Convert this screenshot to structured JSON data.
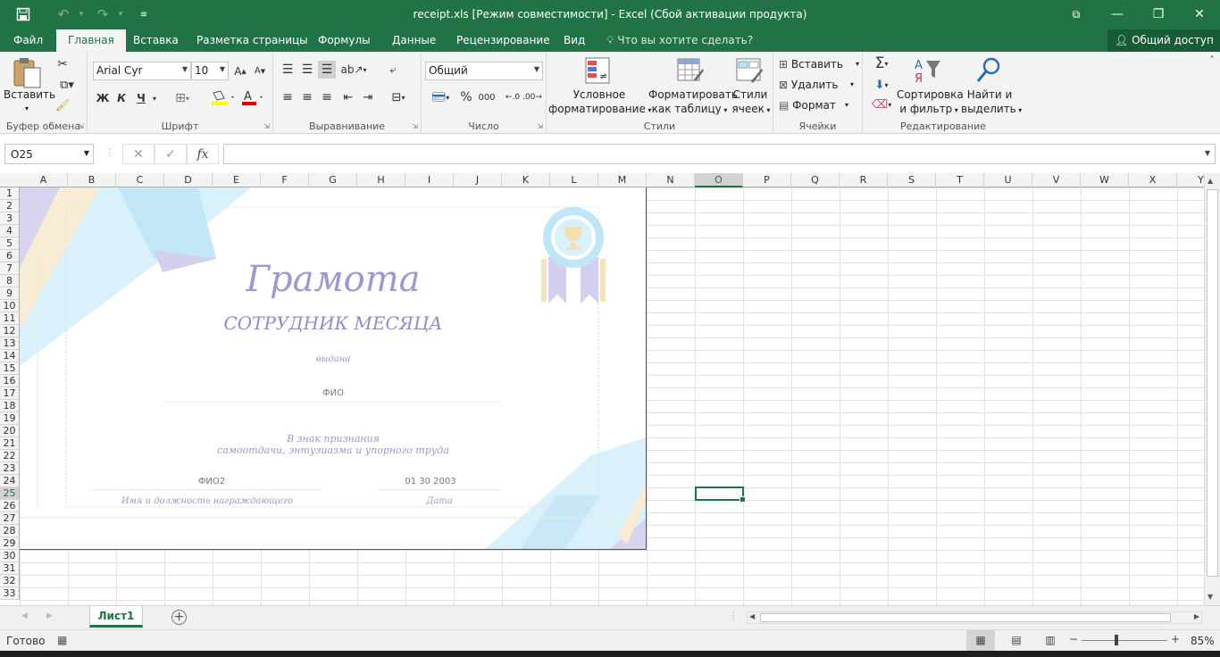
{
  "window": {
    "title": "receipt.xls  [Режим совместимости] - Excel (Сбой активации продукта)",
    "icons": [
      "save-icon",
      "undo-icon",
      "redo-icon",
      "customize-qat-icon"
    ],
    "controls": {
      "ribbon_display": "⧉",
      "minimize": "—",
      "restore": "❐",
      "close": "✕"
    }
  },
  "tabs": [
    {
      "label": "Файл"
    },
    {
      "label": "Главная"
    },
    {
      "label": "Вставка"
    },
    {
      "label": "Разметка страницы"
    },
    {
      "label": "Формулы"
    },
    {
      "label": "Данные"
    },
    {
      "label": "Рецензирование"
    },
    {
      "label": "Вид"
    }
  ],
  "tell_me": "Что вы хотите сделать?",
  "share": "Общий доступ",
  "ribbon": {
    "clipboard": {
      "paste": "Вставить",
      "label": "Буфер обмена"
    },
    "font": {
      "name": "Arial Cyr",
      "size": "10",
      "bold": "Ж",
      "italic": "К",
      "underline": "Ч",
      "label": "Шрифт"
    },
    "alignment": {
      "label": "Выравнивание"
    },
    "number": {
      "format": "Общий",
      "percent": "%",
      "thousands": "000",
      "label": "Число"
    },
    "styles": {
      "conditional": "Условное",
      "conditional2": "форматирование",
      "as_table": "Форматировать",
      "as_table2": "как таблицу",
      "cell_styles": "Стили",
      "cell_styles2": "ячеек",
      "label": "Стили"
    },
    "cells": {
      "insert": "Вставить",
      "delete": "Удалить",
      "format": "Формат",
      "label": "Ячейки"
    },
    "editing": {
      "sort": "Сортировка",
      "sort2": "и фильтр",
      "find": "Найти и",
      "find2": "выделить",
      "label": "Редактирование"
    }
  },
  "formula_bar": {
    "name_box": "O25",
    "cancel": "✕",
    "enter": "✓",
    "fx": "fx",
    "value": ""
  },
  "columns": [
    "A",
    "B",
    "C",
    "D",
    "E",
    "F",
    "G",
    "H",
    "I",
    "J",
    "K",
    "L",
    "M",
    "N",
    "O",
    "P",
    "Q",
    "R",
    "S",
    "T",
    "U",
    "V",
    "W",
    "X",
    "Y"
  ],
  "rows": [
    "1",
    "2",
    "3",
    "4",
    "5",
    "6",
    "7",
    "8",
    "9",
    "10",
    "11",
    "12",
    "13",
    "14",
    "15",
    "16",
    "17",
    "18",
    "19",
    "20",
    "21",
    "22",
    "23",
    "24",
    "25",
    "26",
    "27",
    "28",
    "29",
    "30",
    "31",
    "32",
    "33"
  ],
  "selected": {
    "column": "O",
    "row": "25"
  },
  "certificate": {
    "title": "Грамота",
    "subtitle": "СОТРУДНИК МЕСЯЦА",
    "issued": "выдана",
    "fio": "ФИО",
    "recognition1": "В знак признания",
    "recognition2": "самоотдачи, энтузиазма и упорного труда",
    "fio2": "ФИО2",
    "date_value": "01 30 2003",
    "awarder_label": "Имя и должность награждающего",
    "date_label": "Дата"
  },
  "sheet_tabs": [
    {
      "label": "Лист1"
    }
  ],
  "status": {
    "ready": "Готово",
    "zoom": "85%"
  }
}
